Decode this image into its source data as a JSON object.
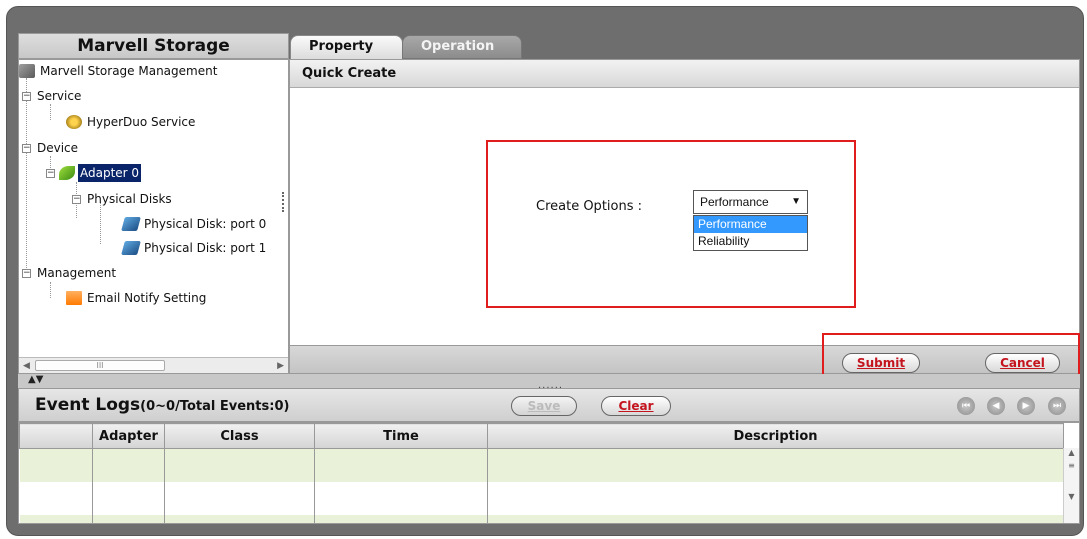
{
  "left_panel": {
    "title": "Marvell Storage",
    "tree": {
      "root": "Marvell Storage Management",
      "service": "Service",
      "hyperduo": "HyperDuo Service",
      "device": "Device",
      "adapter": "Adapter 0",
      "physical_disks": "Physical Disks",
      "disk0": "Physical Disk: port 0",
      "disk1": "Physical Disk: port 1",
      "management": "Management",
      "email": "Email Notify Setting"
    },
    "scroll_thumb": "III"
  },
  "tabs": {
    "property": "Property",
    "operation": "Operation"
  },
  "quick_create": {
    "title": "Quick Create",
    "options_label": "Create Options :",
    "selected": "Performance",
    "options": [
      "Performance",
      "Reliability"
    ]
  },
  "actions": {
    "submit": "Submit",
    "cancel": "Cancel"
  },
  "splitter_dots": "......",
  "event_logs": {
    "title": "Event Logs",
    "subtitle": "(0~0/Total Events:0)",
    "save": "Save",
    "clear": "Clear",
    "columns": [
      "Adapter",
      "Class",
      "Time",
      "Description"
    ]
  },
  "colors": {
    "frame": "#6e6e6e",
    "highlight_box": "#e01c1c",
    "selection": "#0a246a",
    "row_green": "#e9f2d8"
  }
}
